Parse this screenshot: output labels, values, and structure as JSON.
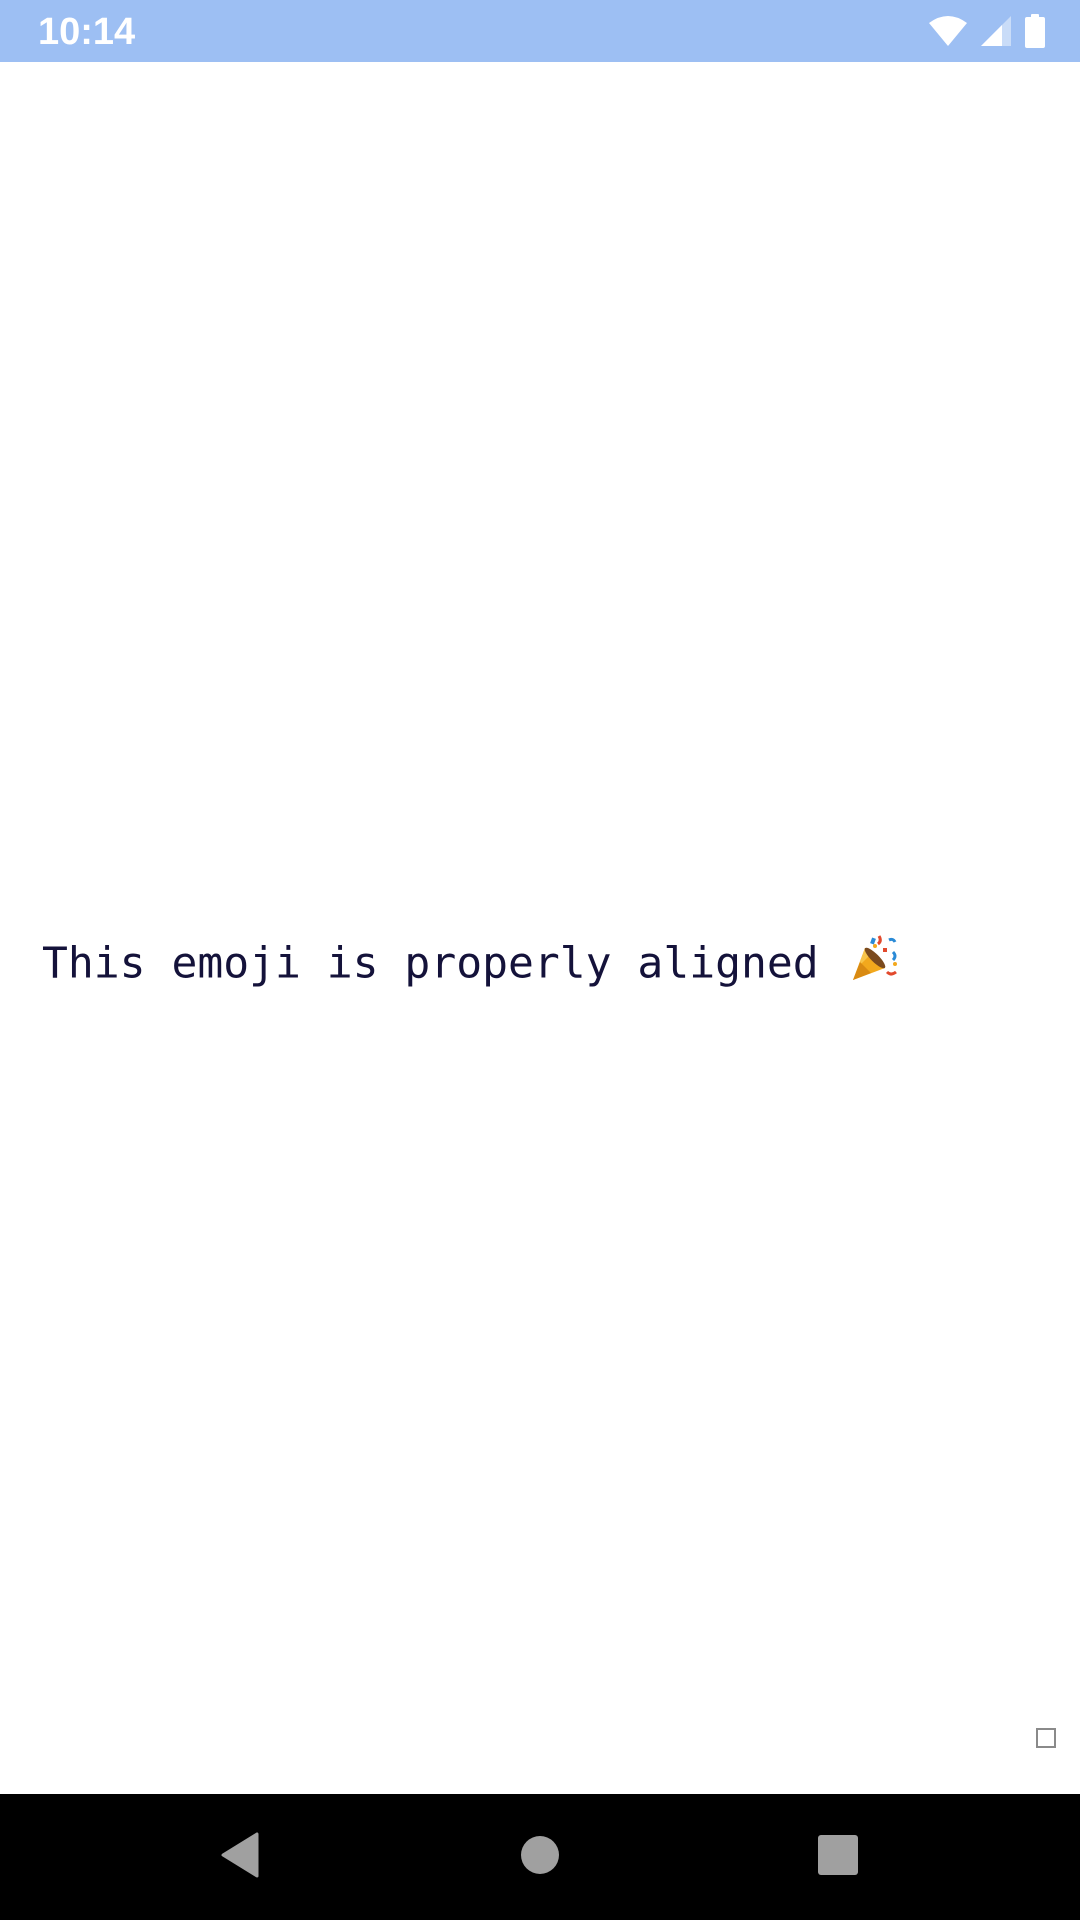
{
  "status_bar": {
    "time": "10:14",
    "icons": [
      "wifi-icon",
      "cellular-signal-icon",
      "battery-icon"
    ],
    "background": "#9dbff3"
  },
  "content": {
    "message": "This emoji is properly aligned",
    "emoji": "party-popper-icon",
    "text_color": "#14123a"
  },
  "nav_bar": {
    "buttons": [
      "back",
      "home",
      "recents"
    ],
    "background": "#000000"
  }
}
